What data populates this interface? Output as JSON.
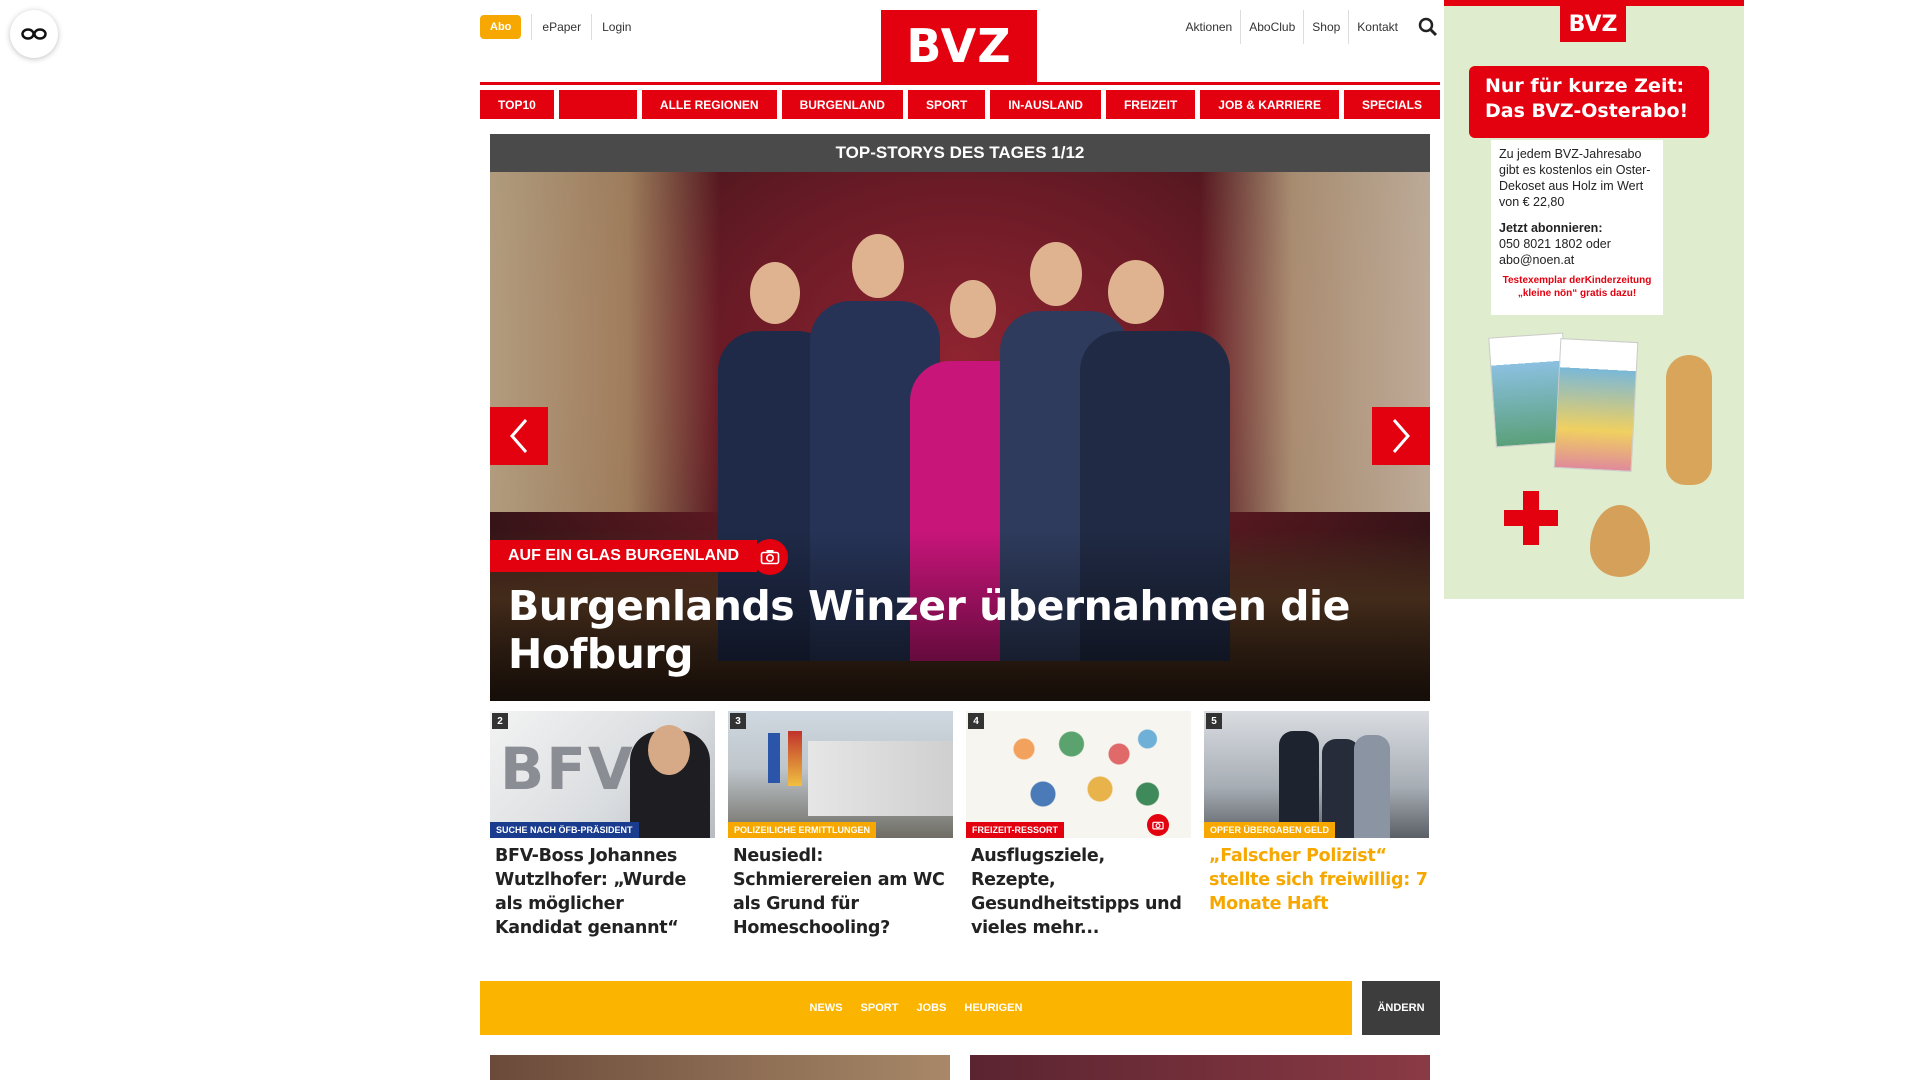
{
  "topbar": {
    "abo_label": "Abo",
    "left_links": [
      "ePaper",
      "Login"
    ],
    "logo_text": "BVZ",
    "right_links": [
      "Aktionen",
      "AboClub",
      "Shop",
      "Kontakt"
    ]
  },
  "nav": {
    "items": [
      "TOP10",
      "",
      "ALLE REGIONEN",
      "BURGENLAND",
      "SPORT",
      "IN-AUSLAND",
      "FREIZEIT",
      "JOB & KARRIERE",
      "SPECIALS"
    ]
  },
  "slider": {
    "header": "TOP-STORYS DES TAGES 1/12",
    "tag": "AUF EIN GLAS BURGENLAND",
    "title": "Burgenlands Winzer übernahmen die Hofburg"
  },
  "cards": [
    {
      "num": "2",
      "tag": "SUCHE NACH ÖFB-PRÄSIDENT",
      "tag_color": "#1a3c8f",
      "title": "BFV-Boss Johannes Wutzlhofer: „Wurde als möglicher Kandidat genannt“",
      "title_color": "#222222"
    },
    {
      "num": "3",
      "tag": "POLIZEILICHE ERMITTLUNGEN",
      "tag_color": "#f6a800",
      "title": "Neusiedl: Schmierereien am WC als Grund für Homeschooling?",
      "title_color": "#222222"
    },
    {
      "num": "4",
      "tag": "FREIZEIT-RESSORT",
      "tag_color": "#e3000f",
      "title": "Ausflugsziele, Rezepte, Gesundheitstipps und vieles mehr...",
      "title_color": "#222222"
    },
    {
      "num": "5",
      "tag": "OPFER ÜBERGABEN GELD",
      "tag_color": "#f6a800",
      "title": "„Falscher Polizist“ stellte sich freiwillig: 7 Monate Haft",
      "title_color": "#f6a800"
    }
  ],
  "card1_logo": "BFV",
  "regionbar": {
    "items": [
      "NEWS",
      "SPORT",
      "JOBS",
      "HEURIGEN"
    ],
    "change_label": "ÄNDERN"
  },
  "ad": {
    "logo": "BVZ",
    "headline_1": "Nur für kurze Zeit:",
    "headline_2": "Das BVZ-Osterabo!",
    "body_1": "Zu jedem BVZ-Jahresabo gibt es kostenlos ein Oster-Dekoset aus Holz im Wert von € 22,80",
    "cta_label": "Jetzt abonnieren:",
    "cta_contact": "050 8021 1802 oder abo@noen.at",
    "red_note": "Testexemplar derKinderzeitung „kleine nön“ gratis dazu!"
  },
  "colors": {
    "brand_red": "#e3000f",
    "accent_yellow": "#fbb500",
    "dark": "#3d3d3d"
  }
}
